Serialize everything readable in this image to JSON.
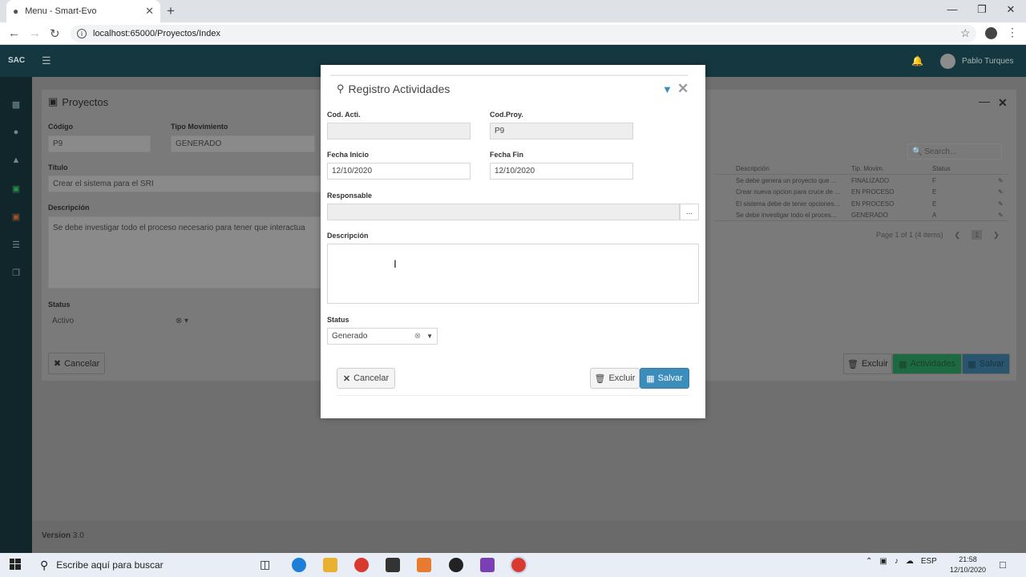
{
  "browser": {
    "tab_title": "Menu - Smart-Evo",
    "url": "localhost:65000/Proyectos/Index"
  },
  "app": {
    "brand": "SAC",
    "user": "Pablo Turques",
    "version_label": "Version",
    "version_value": "3.0"
  },
  "panel": {
    "title": "Proyectos",
    "codigo_label": "Código",
    "codigo_value": "P9",
    "tipo_label": "Tipo Movimiento",
    "tipo_value": "GENERADO",
    "titulo_label": "Título",
    "titulo_value": "Crear el sistema para el SRI",
    "descripcion_label": "Descripción",
    "descripcion_value": "Se debe investigar todo el proceso necesario para tener que interactua",
    "status_label": "Status",
    "status_value": "Activo",
    "cancel_label": "Cancelar",
    "delete_label": "Excluir",
    "activities_label": "Actividades",
    "save_label": "Salvar",
    "search_placeholder": "Search...",
    "table_headers": [
      "Descripción",
      "Tip. Movim.",
      "Status"
    ],
    "table_rows": [
      {
        "desc": "Se debe genera un proyecto que ...",
        "tipo": "FINALIZADO",
        "status": "F"
      },
      {
        "desc": "Crear nueva opcion para cruce de ...",
        "tipo": "EN PROCESO",
        "status": "E"
      },
      {
        "desc": "El sistema debe de tener opciones...",
        "tipo": "EN PROCESO",
        "status": "E"
      },
      {
        "desc": "Se debe investigar todo el proces...",
        "tipo": "GENERADO",
        "status": "A"
      }
    ],
    "pager_text": "Page 1 of 1 (4 items)",
    "pager_page": "1"
  },
  "modal": {
    "title": "Registro Actividades",
    "cod_acti_label": "Cod. Acti.",
    "cod_acti_value": "",
    "cod_proy_label": "Cod.Proy.",
    "cod_proy_value": "P9",
    "fecha_inicio_label": "Fecha Inicio",
    "fecha_inicio_value": "12/10/2020",
    "fecha_fin_label": "Fecha Fin",
    "fecha_fin_value": "12/10/2020",
    "responsable_label": "Responsable",
    "responsable_value": "",
    "responsable_btn": "...",
    "descripcion_label": "Descripción",
    "descripcion_value": "",
    "status_label": "Status",
    "status_value": "Generado",
    "cancel_label": "Cancelar",
    "delete_label": "Excluir",
    "save_label": "Salvar"
  },
  "taskbar": {
    "search_text": "Escribe aquí para buscar",
    "lang": "ESP",
    "time": "21:58",
    "date": "12/10/2020"
  },
  "colors": {
    "primary": "#3c8dbc",
    "success": "#00a65a",
    "topnav": "#15373f",
    "sidebar": "#10262b"
  }
}
